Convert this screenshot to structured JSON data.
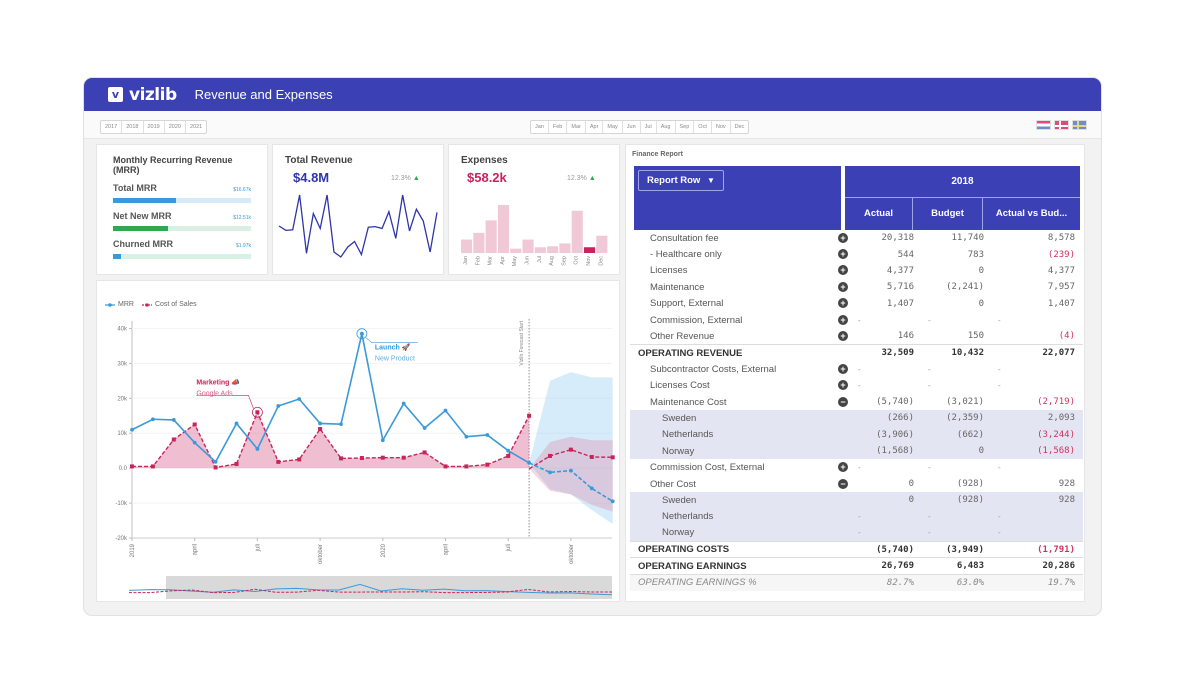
{
  "app": {
    "logo_mark": "v",
    "logo_text": "vizlib",
    "title": "Revenue and Expenses"
  },
  "filters": {
    "years": [
      "2017",
      "2018",
      "2019",
      "2020",
      "2021"
    ],
    "months": [
      "Jan",
      "Feb",
      "Mar",
      "Apr",
      "May",
      "Jun",
      "Jul",
      "Aug",
      "Sep",
      "Oct",
      "Nov",
      "Dec"
    ],
    "languages": [
      {
        "name": "flag-netherlands-icon"
      },
      {
        "name": "flag-denmark-icon"
      },
      {
        "name": "flag-sweden-icon"
      }
    ]
  },
  "mrr_card": {
    "title": "Monthly Recurring Revenue (MRR)",
    "rows": [
      {
        "label": "Total MRR",
        "value": "$16.67k",
        "fill_pct": 46,
        "color": "#3a9ad9",
        "track": "#d6ebf8"
      },
      {
        "label": "Net New MRR",
        "value": "$12.51k",
        "fill_pct": 40,
        "color": "#2fa84f",
        "track": "#d8f0e6"
      },
      {
        "label": "Churned MRR",
        "value": "$1.97k",
        "fill_pct": 6,
        "color": "#3a9ad9",
        "track": "#d8f0e6"
      }
    ]
  },
  "revenue_card": {
    "title": "Total Revenue",
    "value": "$4.8M",
    "trend": "12.3%",
    "trend_arrow": "🡅",
    "accent": "#2e36a8",
    "spark": [
      50,
      43,
      44,
      100,
      6,
      70,
      46,
      100,
      8,
      0,
      16,
      25,
      4,
      48,
      49,
      46,
      73,
      30,
      100,
      42,
      77,
      58,
      8,
      72
    ]
  },
  "expenses_card": {
    "title": "Expenses",
    "value": "$58.2k",
    "trend": "12.3%",
    "trend_arrow": "🡅",
    "accent": "#c8245a",
    "bars": {
      "categories": [
        "Jan",
        "Feb",
        "Mar",
        "Apr",
        "May",
        "Jun",
        "Jul",
        "Aug",
        "Sep",
        "Oct",
        "Nov",
        "Dec"
      ],
      "values": [
        28,
        42,
        68,
        100,
        9,
        28,
        12,
        14,
        20,
        88,
        12,
        36
      ],
      "highlight_index": 10
    }
  },
  "chart_data": {
    "type": "line",
    "title": "",
    "legend": [
      {
        "name": "MRR",
        "color": "#3a9ad9"
      },
      {
        "name": "Cost of Sales",
        "color": "#c8245a"
      }
    ],
    "legend_position": "top-left",
    "ylim": [
      -20000,
      45000
    ],
    "yticks": [
      {
        "value": 40000,
        "label": "40k"
      },
      {
        "value": 30000,
        "label": "30k"
      },
      {
        "value": 20000,
        "label": "20k"
      },
      {
        "value": 10000,
        "label": "10k"
      },
      {
        "value": 0,
        "label": "0.0"
      },
      {
        "value": -10000,
        "label": "-10k"
      },
      {
        "value": -20000,
        "label": "-20k"
      }
    ],
    "xticks": [
      {
        "index": 0,
        "label": "2019"
      },
      {
        "index": 3,
        "label": "april"
      },
      {
        "index": 6,
        "label": "juli"
      },
      {
        "index": 9,
        "label": "oktober"
      },
      {
        "index": 12,
        "label": "2020"
      },
      {
        "index": 15,
        "label": "april"
      },
      {
        "index": 18,
        "label": "juli"
      },
      {
        "index": 21,
        "label": "oktober"
      }
    ],
    "x_count": 24,
    "forecast_start_index": 19,
    "forecast_label": "Vizlib Forecast Start",
    "series": [
      {
        "name": "MRR",
        "values": [
          11000,
          14000,
          13800,
          7300,
          1800,
          12800,
          5500,
          17800,
          19800,
          12800,
          12600,
          38500,
          8000,
          18500,
          11500,
          16500,
          9000,
          9500,
          5000,
          1500
        ],
        "forecast": [
          1500,
          -1200,
          -700,
          -5800,
          -9500
        ],
        "forecast_band": [
          [
            1500,
            1500
          ],
          [
            -6000,
            25000
          ],
          [
            -7500,
            27500
          ],
          [
            -12000,
            26000
          ],
          [
            -16000,
            26000
          ]
        ]
      },
      {
        "name": "Cost of Sales",
        "values": [
          500,
          500,
          8200,
          12500,
          200,
          1200,
          16000,
          1800,
          2500,
          11200,
          2800,
          2900,
          3000,
          3000,
          4500,
          500,
          500,
          1000,
          3500,
          15000
        ],
        "forecast": [
          -200,
          3500,
          5300,
          3200,
          3100
        ],
        "forecast_band": [
          [
            -200,
            -200
          ],
          [
            -6500,
            7500
          ],
          [
            -7500,
            9000
          ],
          [
            -10500,
            8000
          ],
          [
            -12500,
            8000
          ]
        ]
      }
    ],
    "annotations": [
      {
        "series": "Cost of Sales",
        "index": 6,
        "title": "Marketing",
        "subtitle": "Google Ads",
        "icon": "megaphone-icon"
      },
      {
        "series": "MRR",
        "index": 11,
        "title": "Launch",
        "subtitle": "New Product",
        "icon": "rocket-icon"
      }
    ]
  },
  "finance": {
    "title": "Finance Report",
    "report_row_label": "Report Row",
    "year": "2018",
    "columns": [
      "Actual",
      "Budget",
      "Actual vs Bud..."
    ],
    "rows": [
      {
        "label": "Consultation fee",
        "toggle": "+",
        "type": "item",
        "values": [
          "20,318",
          "11,740",
          "8,578"
        ],
        "neg": [
          false,
          false,
          false
        ]
      },
      {
        "label": "- Healthcare only",
        "toggle": "+",
        "type": "item",
        "values": [
          "544",
          "783",
          "(239)"
        ],
        "neg": [
          false,
          false,
          true
        ]
      },
      {
        "label": "Licenses",
        "toggle": "+",
        "type": "item",
        "values": [
          "4,377",
          "0",
          "4,377"
        ],
        "neg": [
          false,
          false,
          false
        ]
      },
      {
        "label": "Maintenance",
        "toggle": "+",
        "type": "item",
        "values": [
          "5,716",
          "(2,241)",
          "7,957"
        ],
        "neg": [
          false,
          false,
          false
        ]
      },
      {
        "label": "Support, External",
        "toggle": "+",
        "type": "item",
        "values": [
          "1,407",
          "0",
          "1,407"
        ],
        "neg": [
          false,
          false,
          false
        ]
      },
      {
        "label": "Commission, External",
        "toggle": "+",
        "type": "item",
        "values": [
          "-",
          "-",
          "-"
        ],
        "neg": [
          false,
          false,
          false
        ]
      },
      {
        "label": "Other Revenue",
        "toggle": "+",
        "type": "item",
        "values": [
          "146",
          "150",
          "(4)"
        ],
        "neg": [
          false,
          false,
          true
        ]
      },
      {
        "label": "OPERATING REVENUE",
        "toggle": "",
        "type": "total",
        "values": [
          "32,509",
          "10,432",
          "22,077"
        ],
        "neg": [
          false,
          false,
          false
        ]
      },
      {
        "label": "Subcontractor Costs, External",
        "toggle": "+",
        "type": "item",
        "values": [
          "-",
          "-",
          "-"
        ],
        "neg": [
          false,
          false,
          false
        ]
      },
      {
        "label": "Licenses Cost",
        "toggle": "+",
        "type": "item",
        "values": [
          "-",
          "-",
          "-"
        ],
        "neg": [
          false,
          false,
          false
        ]
      },
      {
        "label": "Maintenance Cost",
        "toggle": "−",
        "type": "item",
        "values": [
          "(5,740)",
          "(3,021)",
          "(2,719)"
        ],
        "neg": [
          false,
          false,
          true
        ]
      },
      {
        "label": "Sweden",
        "toggle": "",
        "type": "sub",
        "values": [
          "(266)",
          "(2,359)",
          "2,093"
        ],
        "neg": [
          false,
          false,
          false
        ]
      },
      {
        "label": "Netherlands",
        "toggle": "",
        "type": "sub",
        "values": [
          "(3,906)",
          "(662)",
          "(3,244)"
        ],
        "neg": [
          false,
          false,
          true
        ]
      },
      {
        "label": "Norway",
        "toggle": "",
        "type": "sub",
        "values": [
          "(1,568)",
          "0",
          "(1,568)"
        ],
        "neg": [
          false,
          false,
          true
        ]
      },
      {
        "label": "Commission Cost, External",
        "toggle": "+",
        "type": "item",
        "values": [
          "-",
          "-",
          "-"
        ],
        "neg": [
          false,
          false,
          false
        ]
      },
      {
        "label": "Other Cost",
        "toggle": "−",
        "type": "item",
        "values": [
          "0",
          "(928)",
          "928"
        ],
        "neg": [
          false,
          false,
          false
        ]
      },
      {
        "label": "Sweden",
        "toggle": "",
        "type": "sub",
        "values": [
          "0",
          "(928)",
          "928"
        ],
        "neg": [
          false,
          false,
          false
        ]
      },
      {
        "label": "Netherlands",
        "toggle": "",
        "type": "sub",
        "values": [
          "-",
          "-",
          "-"
        ],
        "neg": [
          false,
          false,
          false
        ]
      },
      {
        "label": "Norway",
        "toggle": "",
        "type": "sub",
        "values": [
          "-",
          "-",
          "-"
        ],
        "neg": [
          false,
          false,
          false
        ]
      },
      {
        "label": "OPERATING COSTS",
        "toggle": "",
        "type": "total",
        "values": [
          "(5,740)",
          "(3,949)",
          "(1,791)"
        ],
        "neg": [
          false,
          false,
          true
        ]
      },
      {
        "label": "OPERATING EARNINGS",
        "toggle": "",
        "type": "total",
        "values": [
          "26,769",
          "6,483",
          "20,286"
        ],
        "neg": [
          false,
          false,
          false
        ]
      },
      {
        "label": "OPERATING EARNINGS %",
        "toggle": "",
        "type": "pct",
        "values": [
          "82.7%",
          "63.0%",
          "19.7%"
        ],
        "neg": [
          false,
          false,
          false
        ]
      }
    ]
  }
}
